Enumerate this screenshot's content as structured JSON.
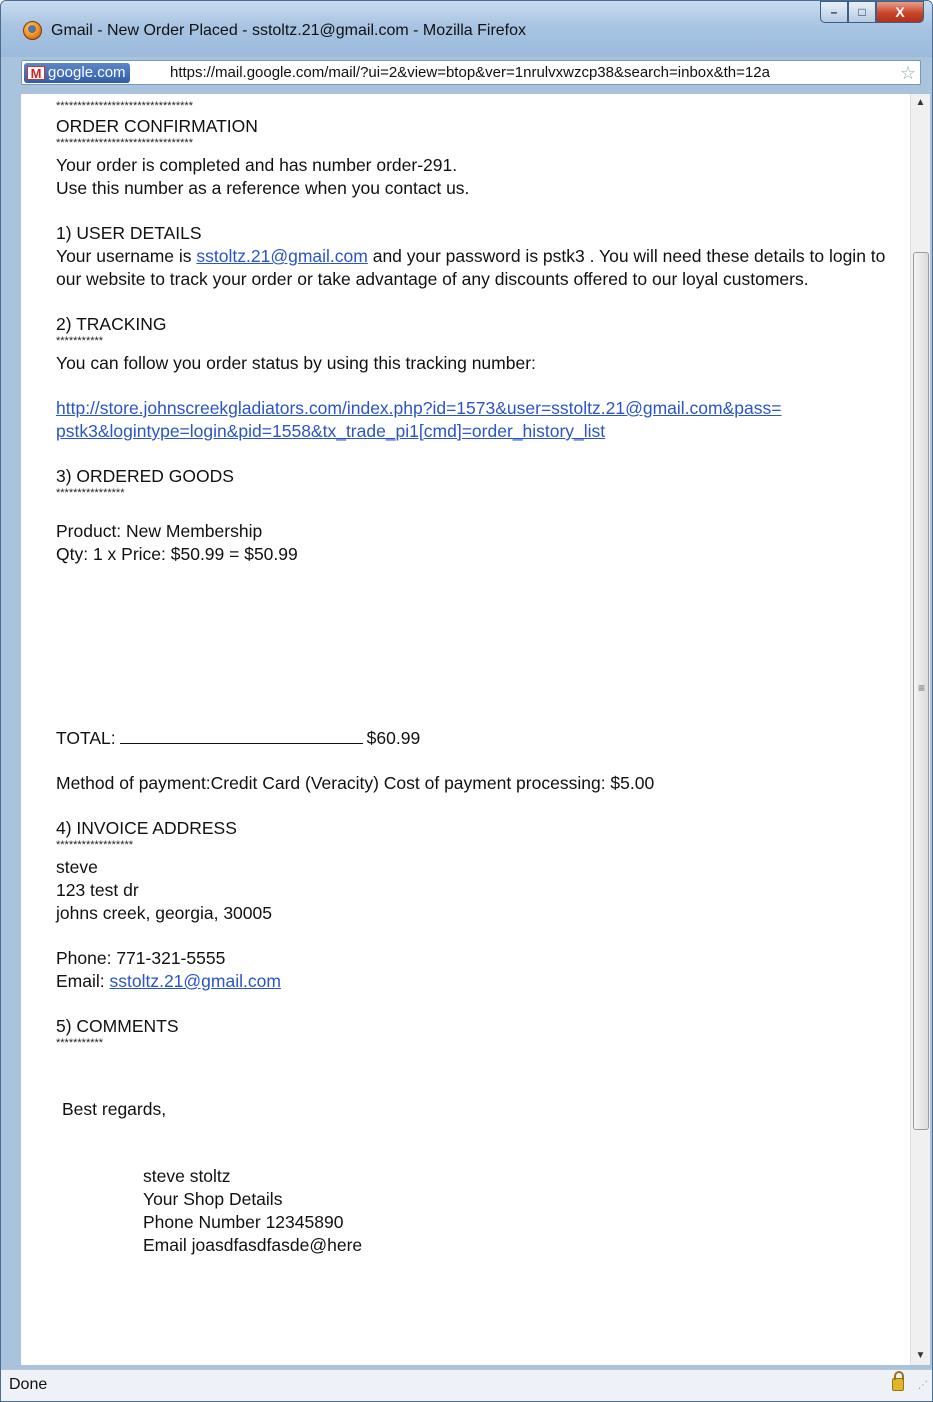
{
  "window": {
    "title": "Gmail - New Order Placed - sstoltz.21@gmail.com - Mozilla Firefox",
    "controls": {
      "minimize": "–",
      "maximize": "□",
      "close": "X"
    }
  },
  "urlbar": {
    "site": "google.com",
    "url": "https://mail.google.com/mail/?ui=2&view=btop&ver=1nrulvxwzcp38&search=inbox&th=12a"
  },
  "email": {
    "stars_top": "********************************",
    "heading": "ORDER CONFIRMATION",
    "stars_heading": "********************************",
    "intro_line1": "Your order is completed and has number order-291.",
    "intro_line2": "Use this number as a reference when you contact us.",
    "section1_title": "1) USER DETAILS",
    "user_text_pre": "Your username is ",
    "user_email": "sstoltz.21@gmail.com",
    "user_text_post": " and your password is pstk3  . You will need these details to login to our website to track your order or take advantage of any discounts offered to our loyal customers.",
    "section2_title": "2) TRACKING",
    "section2_stars": "***********",
    "tracking_text": "You can follow you order status by using this tracking number:",
    "tracking_link_line1": "http://store.johnscreekgladiators.com/index.php?id=1573&user=sstoltz.21@gmail.com&pass=",
    "tracking_link_line2": "pstk3&logintype=login&pid=1558&tx_trade_pi1[cmd]=order_history_list",
    "section3_title": "3) ORDERED GOODS",
    "section3_stars": "****************",
    "product_line": "Product: New Membership",
    "qty_line": "Qty: 1 x Price: $50.99 = $50.99",
    "total_label": "TOTAL:",
    "total_value": "$60.99",
    "payment_line": "Method of payment:Credit Card (Veracity)   Cost of payment processing: $5.00",
    "section4_title": "4) INVOICE ADDRESS",
    "section4_stars": "******************",
    "address_name": "steve",
    "address_street": "123 test dr",
    "address_city": "johns creek, georgia, 30005",
    "phone_line": "Phone: 771-321-5555",
    "email_label": "Email: ",
    "invoice_email": "sstoltz.21@gmail.com",
    "section5_title": "5) COMMENTS",
    "section5_stars": "***********",
    "regards": "Best regards,",
    "sig_name": "steve stoltz",
    "sig_shop": "Your Shop Details",
    "sig_phone": "Phone Number 12345890",
    "sig_email": "Email joasdfasdfasde@here"
  },
  "statusbar": {
    "text": "Done"
  },
  "icons": {
    "browser": "firefox-icon",
    "site": "gmail-icon",
    "bookmark": "star-icon",
    "security": "lock-icon"
  }
}
